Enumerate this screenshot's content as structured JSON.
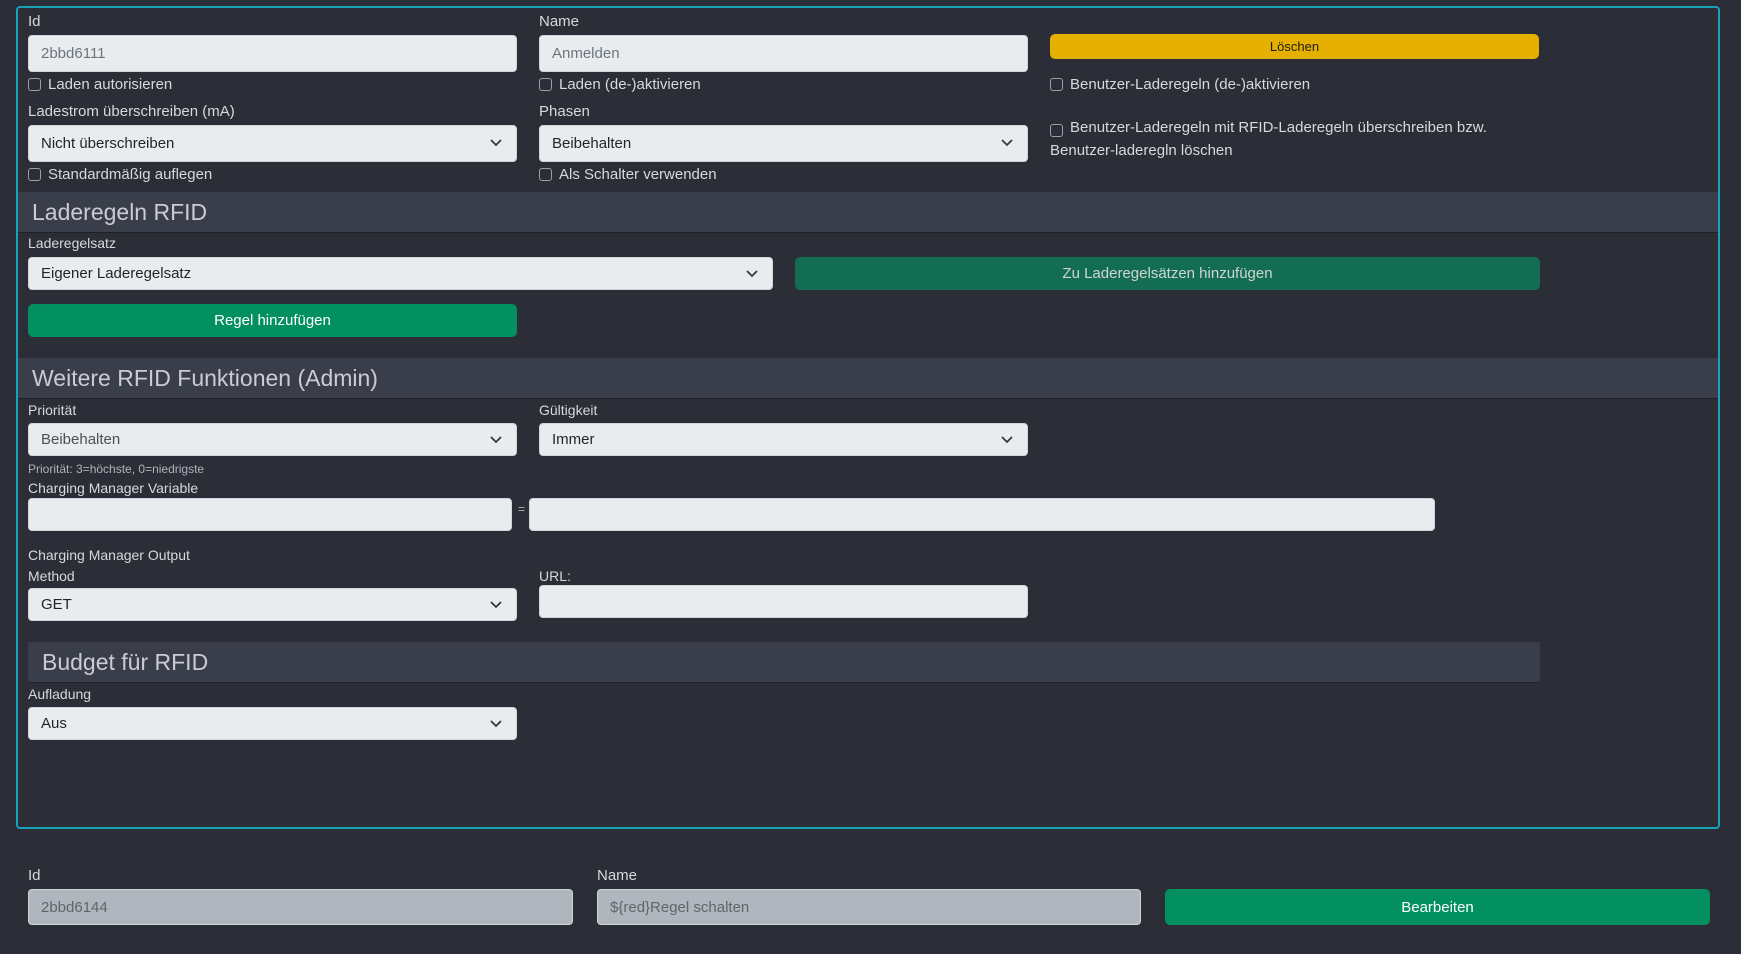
{
  "rfid_card": {
    "id_label": "Id",
    "id_value": "2bbd6111",
    "name_label": "Name",
    "name_value": "Anmelden",
    "delete_button": "Löschen",
    "checkbox_laden_autorisieren": "Laden autorisieren",
    "checkbox_laden_deaktivieren": "Laden (de-)aktivieren",
    "checkbox_benutzer_laderegeln": "Benutzer-Laderegeln (de-)aktivieren",
    "ladestrom_label": "Ladestrom überschreiben (mA)",
    "ladestrom_value": "Nicht überschreiben",
    "phasen_label": "Phasen",
    "phasen_value": "Beibehalten",
    "checkbox_overwrite_text": "Benutzer-Laderegeln mit RFID-Laderegeln überschreiben bzw. Benutzer-laderegln löschen",
    "checkbox_standard_auflegen": "Standardmäßig auflegen",
    "checkbox_als_schalter": "Als Schalter verwenden"
  },
  "laderegeln": {
    "title": "Laderegeln RFID",
    "ruleset_label": "Laderegelsatz",
    "ruleset_value": "Eigener Laderegelsatz",
    "add_to_rulesets_button": "Zu Laderegelsätzen hinzufügen",
    "add_rule_button": "Regel hinzufügen"
  },
  "weitere": {
    "title": "Weitere RFID Funktionen (Admin)",
    "prioritaet_label": "Priorität",
    "prioritaet_value": "Beibehalten",
    "prioritaet_hint": "Priorität: 3=höchste, 0=niedrigste",
    "gueltigkeit_label": "Gültigkeit",
    "gueltigkeit_value": "Immer",
    "cm_variable_label": "Charging Manager Variable",
    "equals": "=",
    "cm_output_label": "Charging Manager Output",
    "method_label": "Method",
    "method_value": "GET",
    "url_label": "URL:"
  },
  "budget": {
    "title": "Budget für RFID",
    "aufladung_label": "Aufladung",
    "aufladung_value": "Aus"
  },
  "second_row": {
    "id_label": "Id",
    "id_value": "2bbd6144",
    "name_label": "Name",
    "name_value": "${red}Regel schalten",
    "edit_button": "Bearbeiten"
  },
  "colors": {
    "background": "#2b2d37",
    "card_border": "#17a2b8",
    "warning": "#e6b000",
    "success": "#039060",
    "teal": "#136d52"
  }
}
